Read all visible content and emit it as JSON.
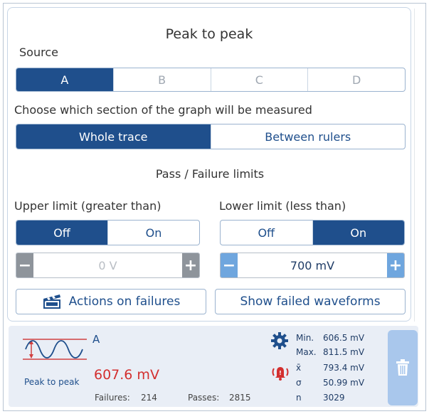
{
  "panel": {
    "title": "Peak to peak",
    "source_label": "Source",
    "sources": [
      "A",
      "B",
      "C",
      "D"
    ],
    "section_prompt": "Choose which section of the graph will be measured",
    "section_options": [
      "Whole trace",
      "Between rulers"
    ],
    "limits_heading": "Pass / Failure limits",
    "upper": {
      "label": "Upper limit (greater than)",
      "off": "Off",
      "on": "On",
      "value": "0 V"
    },
    "lower": {
      "label": "Lower limit (less than)",
      "off": "Off",
      "on": "On",
      "value": "700 mV"
    },
    "actions_button": "Actions on failures",
    "show_failed_button": "Show failed waveforms"
  },
  "result": {
    "channel": "A",
    "measurement_name": "Peak to peak",
    "value": "607.6 mV",
    "failures_label": "Failures:",
    "failures": "214",
    "passes_label": "Passes:",
    "passes": "2815",
    "stats": {
      "min_label": "Min.",
      "min": "606.5 mV",
      "max_label": "Max.",
      "max": "811.5 mV",
      "mean_label": "x̄",
      "mean": "793.4 mV",
      "sigma_label": "σ",
      "sigma": "50.99 mV",
      "n_label": "n",
      "n": "3029"
    }
  },
  "colors": {
    "accent": "#1f4f8c",
    "value_red": "#d32f2f",
    "stepper_enabled": "#6fa6de",
    "trash_bg": "#a9c7ec"
  }
}
